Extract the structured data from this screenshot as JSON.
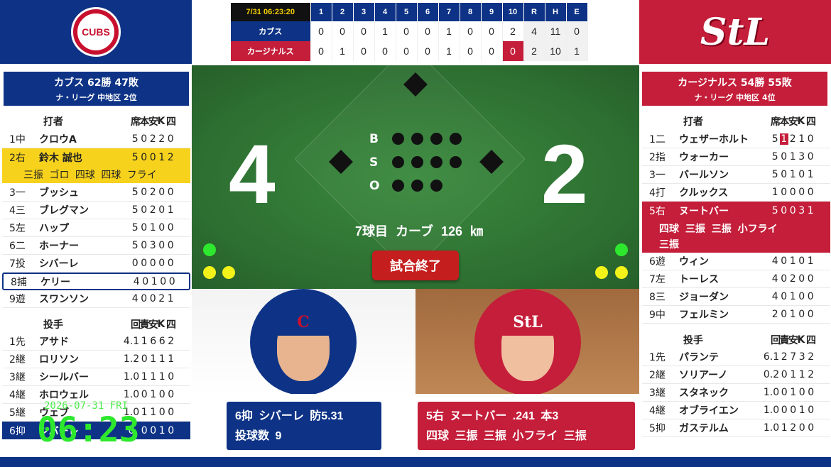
{
  "scoreboard": {
    "timestamp": "7/31 06:23:20",
    "innings": [
      "1",
      "2",
      "3",
      "4",
      "5",
      "6",
      "7",
      "8",
      "9",
      "10"
    ],
    "rhe": [
      "R",
      "H",
      "E"
    ],
    "away": {
      "name": "カブス",
      "scores": [
        "0",
        "0",
        "0",
        "1",
        "0",
        "0",
        "1",
        "0",
        "0",
        "2"
      ],
      "rhe": [
        "4",
        "11",
        "0"
      ]
    },
    "home": {
      "name": "カージナルス",
      "scores": [
        "0",
        "1",
        "0",
        "0",
        "0",
        "0",
        "1",
        "0",
        "0",
        "0"
      ],
      "rhe": [
        "2",
        "10",
        "1"
      ]
    }
  },
  "left": {
    "logo": "CUBS",
    "team": "カブス 62勝 47敗",
    "league": "ナ・リーグ 中地区 2位",
    "batter_header": "打者",
    "batter_cols": [
      "席",
      "本",
      "安",
      "K",
      "四"
    ],
    "batters": [
      {
        "no": "1中",
        "name": "クロウA",
        "stats": [
          "5",
          "0",
          "2",
          "2",
          "0"
        ]
      },
      {
        "no": "2右",
        "name": "鈴木 誠也",
        "stats": [
          "5",
          "0",
          "0",
          "1",
          "2"
        ],
        "detail": "三振 ゴロ 四球 四球 フライ"
      },
      {
        "no": "3一",
        "name": "ブッシュ",
        "stats": [
          "5",
          "0",
          "2",
          "0",
          "0"
        ]
      },
      {
        "no": "4三",
        "name": "ブレグマン",
        "stats": [
          "5",
          "0",
          "2",
          "0",
          "1"
        ]
      },
      {
        "no": "5左",
        "name": "ハップ",
        "stats": [
          "5",
          "0",
          "1",
          "0",
          "0"
        ]
      },
      {
        "no": "6二",
        "name": "ホーナー",
        "stats": [
          "5",
          "0",
          "3",
          "0",
          "0"
        ]
      },
      {
        "no": "7投",
        "name": "シバーレ",
        "stats": [
          "0",
          "0",
          "0",
          "0",
          "0"
        ]
      },
      {
        "no": "8捕",
        "name": "ケリー",
        "stats": [
          "4",
          "0",
          "1",
          "0",
          "0"
        ]
      },
      {
        "no": "9遊",
        "name": "スワンソン",
        "stats": [
          "4",
          "0",
          "0",
          "2",
          "1"
        ]
      }
    ],
    "pitcher_header": "投手",
    "pitcher_cols": [
      "回",
      "責",
      "安",
      "K",
      "四"
    ],
    "pitchers": [
      {
        "no": "1先",
        "name": "アサド",
        "stats": [
          "4.1",
          "1",
          "6",
          "6",
          "2"
        ]
      },
      {
        "no": "2継",
        "name": "ロリソン",
        "stats": [
          "1.2",
          "0",
          "1",
          "1",
          "1"
        ]
      },
      {
        "no": "3継",
        "name": "シールバー",
        "stats": [
          "1.0",
          "1",
          "1",
          "1",
          "0"
        ]
      },
      {
        "no": "4継",
        "name": "ホロウェル",
        "stats": [
          "1.0",
          "0",
          "1",
          "0",
          "0"
        ]
      },
      {
        "no": "5継",
        "name": "ウェブ",
        "stats": [
          "1.0",
          "1",
          "1",
          "0",
          "0"
        ]
      },
      {
        "no": "6抑",
        "name": "シバーレ",
        "stats": [
          "0",
          "0",
          "0",
          "1",
          "0"
        ]
      }
    ]
  },
  "right": {
    "logo": "StL",
    "team": "カージナルス 54勝 55敗",
    "league": "ナ・リーグ 中地区 4位",
    "batter_header": "打者",
    "batter_cols": [
      "席",
      "本",
      "安",
      "K",
      "四"
    ],
    "batters": [
      {
        "no": "1二",
        "name": "ウェザーホルト",
        "stats": [
          "5",
          "1",
          "2",
          "1",
          "0"
        ]
      },
      {
        "no": "2指",
        "name": "ウォーカー",
        "stats": [
          "5",
          "0",
          "1",
          "3",
          "0"
        ]
      },
      {
        "no": "3一",
        "name": "バールソン",
        "stats": [
          "5",
          "0",
          "1",
          "0",
          "1"
        ]
      },
      {
        "no": "4打",
        "name": "クルックス",
        "stats": [
          "1",
          "0",
          "0",
          "0",
          "0"
        ]
      },
      {
        "no": "5右",
        "name": "ヌートバー",
        "stats": [
          "5",
          "0",
          "0",
          "3",
          "1"
        ],
        "detail1": "四球 三振 三振 小フライ",
        "detail2": "三振"
      },
      {
        "no": "6遊",
        "name": "ウィン",
        "stats": [
          "4",
          "0",
          "1",
          "0",
          "1"
        ]
      },
      {
        "no": "7左",
        "name": "トーレス",
        "stats": [
          "4",
          "0",
          "2",
          "0",
          "0"
        ]
      },
      {
        "no": "8三",
        "name": "ジョーダン",
        "stats": [
          "4",
          "0",
          "1",
          "0",
          "0"
        ]
      },
      {
        "no": "9中",
        "name": "フェルミン",
        "stats": [
          "2",
          "0",
          "1",
          "0",
          "0"
        ]
      }
    ],
    "pitcher_header": "投手",
    "pitcher_cols": [
      "回",
      "責",
      "安",
      "K",
      "四"
    ],
    "pitchers": [
      {
        "no": "1先",
        "name": "パランテ",
        "stats": [
          "6.1",
          "2",
          "7",
          "3",
          "2"
        ]
      },
      {
        "no": "2継",
        "name": "ソリアーノ",
        "stats": [
          "0.2",
          "0",
          "1",
          "1",
          "2"
        ]
      },
      {
        "no": "3継",
        "name": "スタネック",
        "stats": [
          "1.0",
          "0",
          "1",
          "0",
          "0"
        ]
      },
      {
        "no": "4継",
        "name": "オブライエン",
        "stats": [
          "1.0",
          "0",
          "0",
          "1",
          "0"
        ]
      },
      {
        "no": "5抑",
        "name": "ガステルム",
        "stats": [
          "1.0",
          "1",
          "2",
          "0",
          "0"
        ]
      }
    ]
  },
  "field": {
    "away_score": "4",
    "home_score": "2",
    "count_labels": [
      "B",
      "S",
      "O"
    ],
    "pitch_info": "7球目 カーブ 126 ㎞",
    "status": "試合終了"
  },
  "cards": {
    "away": {
      "line1": "6抑 シバーレ 防5.31",
      "line2": "投球数 9",
      "cap": "C"
    },
    "home": {
      "line1": "5右 ヌートバー .241 本3",
      "line2": "四球 三振 三振 小フライ 三振",
      "cap": "StL"
    }
  },
  "overlay": {
    "date": "2026-07-31 FRI",
    "time": "06:23"
  }
}
